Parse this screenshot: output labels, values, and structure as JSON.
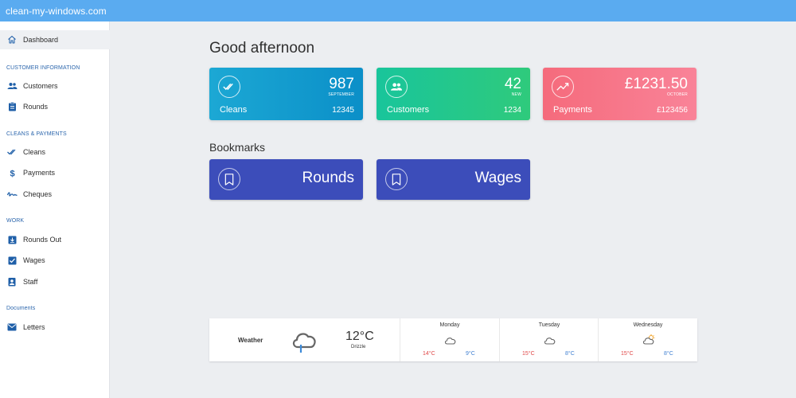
{
  "app": {
    "title": "clean-my-windows.com"
  },
  "sidebar": {
    "dashboard": "Dashboard",
    "sections": {
      "customer_information": "CUSTOMER INFORMATION",
      "cleans_payments": "CLEANS & PAYMENTS",
      "work": "WORK",
      "documents": "Documents"
    },
    "items": {
      "customers": "Customers",
      "rounds": "Rounds",
      "cleans": "Cleans",
      "payments": "Payments",
      "cheques": "Cheques",
      "rounds_out": "Rounds Out",
      "wages": "Wages",
      "staff": "Staff",
      "letters": "Letters"
    },
    "icons": [
      "home-icon",
      "people-icon",
      "clipboard-icon",
      "double-check-icon",
      "dollar-icon",
      "signature-icon",
      "download-box-icon",
      "check-box-icon",
      "badge-icon",
      "mail-icon"
    ]
  },
  "main": {
    "greeting": "Good afternoon",
    "bookmarks_title": "Bookmarks"
  },
  "cards": {
    "cleans": {
      "value": "987",
      "caption": "SEPTEMBER",
      "name": "Cleans",
      "sub": "12345",
      "icon": "double-check-icon"
    },
    "customers": {
      "value": "42",
      "caption": "NEW",
      "name": "Customers",
      "sub": "1234",
      "icon": "people-icon"
    },
    "payments": {
      "value": "£1231.50",
      "caption": "OCTOBER",
      "name": "Payments",
      "sub": "£123456",
      "icon": "trending-up-icon"
    }
  },
  "bookmarks": {
    "rounds": "Rounds",
    "wages": "Wages",
    "icon": "bookmark-icon"
  },
  "weather": {
    "label": "Weather",
    "temp": "12°C",
    "condition": "Drizzle",
    "days": [
      {
        "name": "Monday",
        "high": "14°C",
        "low": "9°C",
        "icon": "cloud-icon"
      },
      {
        "name": "Tuesday",
        "high": "15°C",
        "low": "8°C",
        "icon": "cloud-icon"
      },
      {
        "name": "Wednesday",
        "high": "15°C",
        "low": "8°C",
        "icon": "partly-cloudy-icon"
      }
    ]
  },
  "colors": {
    "topbar": "#5aabf0",
    "section_heading": "#2d67ad",
    "nav_icon": "#1f5fa8",
    "card_cleans": "#0b8fc8",
    "card_customers": "#2fca7c",
    "card_payments": "#f98398",
    "bookmark": "#3c4dba",
    "temp_high": "#e04848",
    "temp_low": "#3f7fd1"
  }
}
